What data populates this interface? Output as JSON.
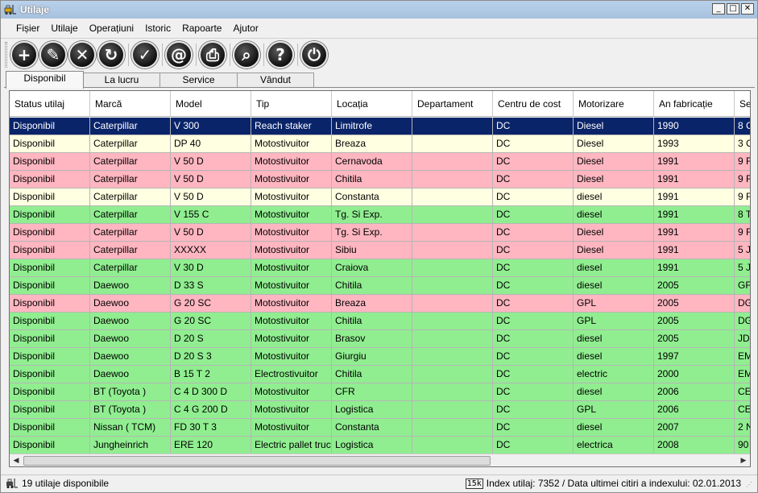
{
  "window": {
    "title": "Utilaje",
    "controls": {
      "minimize": "_",
      "maximize": "□",
      "close": "✕"
    }
  },
  "menu": [
    "Fișier",
    "Utilaje",
    "Operațiuni",
    "Istoric",
    "Rapoarte",
    "Ajutor"
  ],
  "toolbar": {
    "buttons": [
      {
        "name": "add-icon",
        "glyph": "+"
      },
      {
        "name": "edit-icon",
        "glyph": "✎"
      },
      {
        "name": "delete-icon",
        "glyph": "✕"
      },
      {
        "name": "refresh-icon",
        "glyph": "↻"
      },
      {
        "name": "check-icon",
        "glyph": "✓"
      },
      {
        "name": "email-icon",
        "glyph": "@"
      },
      {
        "name": "print-icon",
        "glyph": "⎙"
      },
      {
        "name": "search-icon",
        "glyph": "⌕"
      },
      {
        "name": "help-icon",
        "glyph": "?"
      },
      {
        "name": "power-icon",
        "glyph": "⏻"
      }
    ]
  },
  "tabs": [
    "Disponibil",
    "La lucru",
    "Service",
    "Vândut"
  ],
  "table": {
    "columns": [
      "Status utilaj",
      "Marcă",
      "Model",
      "Tip",
      "Locația",
      "Departament",
      "Centru de cost",
      "Motorizare",
      "An fabricație",
      "Se"
    ],
    "rows": [
      {
        "style": "selected",
        "cells": [
          "Disponibil",
          "Caterpillar",
          "V 300",
          "Reach staker",
          "Limitrofe",
          "",
          "DC",
          "Diesel",
          "1990",
          "8 C"
        ]
      },
      {
        "style": "yellow",
        "cells": [
          "Disponibil",
          "Caterpillar",
          "DP 40",
          "Motostivuitor",
          "Breaza",
          "",
          "DC",
          "Diesel",
          "1993",
          "3 C"
        ]
      },
      {
        "style": "pink",
        "cells": [
          "Disponibil",
          "Caterpillar",
          "V 50 D",
          "Motostivuitor",
          "Cernavoda",
          "",
          "DC",
          "Diesel",
          "1991",
          "9 F"
        ]
      },
      {
        "style": "pink",
        "cells": [
          "Disponibil",
          "Caterpillar",
          "V 50 D",
          "Motostivuitor",
          "Chitila",
          "",
          "DC",
          "Diesel",
          "1991",
          "9 F"
        ]
      },
      {
        "style": "yellow",
        "cells": [
          "Disponibil",
          "Caterpillar",
          "V 50 D",
          "Motostivuitor",
          "Constanta",
          "",
          "DC",
          "diesel",
          "1991",
          "9 F"
        ]
      },
      {
        "style": "green",
        "cells": [
          "Disponibil",
          "Caterpillar",
          "V 155 C",
          "Motostivuitor",
          "Tg. Si Exp.",
          "",
          "DC",
          "diesel",
          "1991",
          "8 T"
        ]
      },
      {
        "style": "pink",
        "cells": [
          "Disponibil",
          "Caterpillar",
          "V 50 D",
          "Motostivuitor",
          "Tg. Si Exp.",
          "",
          "DC",
          "Diesel",
          "1991",
          "9 F"
        ]
      },
      {
        "style": "pink",
        "cells": [
          "Disponibil",
          "Caterpillar",
          "XXXXX",
          "Motostivuitor",
          "Sibiu",
          "",
          "DC",
          "Diesel",
          "1991",
          "5 J"
        ]
      },
      {
        "style": "green",
        "cells": [
          "Disponibil",
          "Caterpillar",
          "V 30 D",
          "Motostivuitor",
          "Craiova",
          "",
          "DC",
          "diesel",
          "1991",
          "5 J"
        ]
      },
      {
        "style": "green",
        "cells": [
          "Disponibil",
          "Daewoo",
          "D 33 S",
          "Motostivuitor",
          "Chitila",
          "",
          "DC",
          "diesel",
          "2005",
          "GF"
        ]
      },
      {
        "style": "pink",
        "cells": [
          "Disponibil",
          "Daewoo",
          "G 20 SC",
          "Motostivuitor",
          "Breaza",
          "",
          "DC",
          "GPL",
          "2005",
          "DG"
        ]
      },
      {
        "style": "green",
        "cells": [
          "Disponibil",
          "Daewoo",
          "G 20 SC",
          "Motostivuitor",
          "Chitila",
          "",
          "DC",
          "GPL",
          "2005",
          "DG"
        ]
      },
      {
        "style": "green",
        "cells": [
          "Disponibil",
          "Daewoo",
          "D 20 S",
          "Motostivuitor",
          "Brasov",
          "",
          "DC",
          "diesel",
          "2005",
          "JD"
        ]
      },
      {
        "style": "green",
        "cells": [
          "Disponibil",
          "Daewoo",
          "D 20 S 3",
          "Motostivuitor",
          "Giurgiu",
          "",
          "DC",
          "diesel",
          "1997",
          "EM"
        ]
      },
      {
        "style": "green",
        "cells": [
          "Disponibil",
          "Daewoo",
          "B 15 T 2",
          "Electrostivuitor",
          "Chitila",
          "",
          "DC",
          "electric",
          "2000",
          "EM"
        ]
      },
      {
        "style": "green",
        "cells": [
          "Disponibil",
          "BT (Toyota )",
          "C 4 D 300 D",
          "Motostivuitor",
          "CFR",
          "",
          "DC",
          "diesel",
          "2006",
          "CE"
        ]
      },
      {
        "style": "green",
        "cells": [
          "Disponibil",
          "BT (Toyota )",
          "C 4 G 200 D",
          "Motostivuitor",
          "Logistica",
          "",
          "DC",
          "GPL",
          "2006",
          "CE"
        ]
      },
      {
        "style": "green",
        "cells": [
          "Disponibil",
          "Nissan ( TCM)",
          "FD 30 T 3",
          "Motostivuitor",
          "Constanta",
          "",
          "DC",
          "diesel",
          "2007",
          "2 N"
        ]
      },
      {
        "style": "green",
        "cells": [
          "Disponibil",
          "Jungheinrich",
          "ERE 120",
          "Electric pallet truck",
          "Logistica",
          "",
          "DC",
          "electrica",
          "2008",
          "90"
        ]
      }
    ]
  },
  "statusbar": {
    "left_text": "19 utilaje disponibile",
    "index_icon_text": "15k",
    "right_text": "Index utilaj: 7352 / Data ultimei citiri a indexului: 02.01.2013"
  },
  "colors": {
    "selected_row": "#0a246a",
    "yellow_row": "#ffffe1",
    "pink_row": "#ffb6c1",
    "green_row": "#90ee90"
  }
}
